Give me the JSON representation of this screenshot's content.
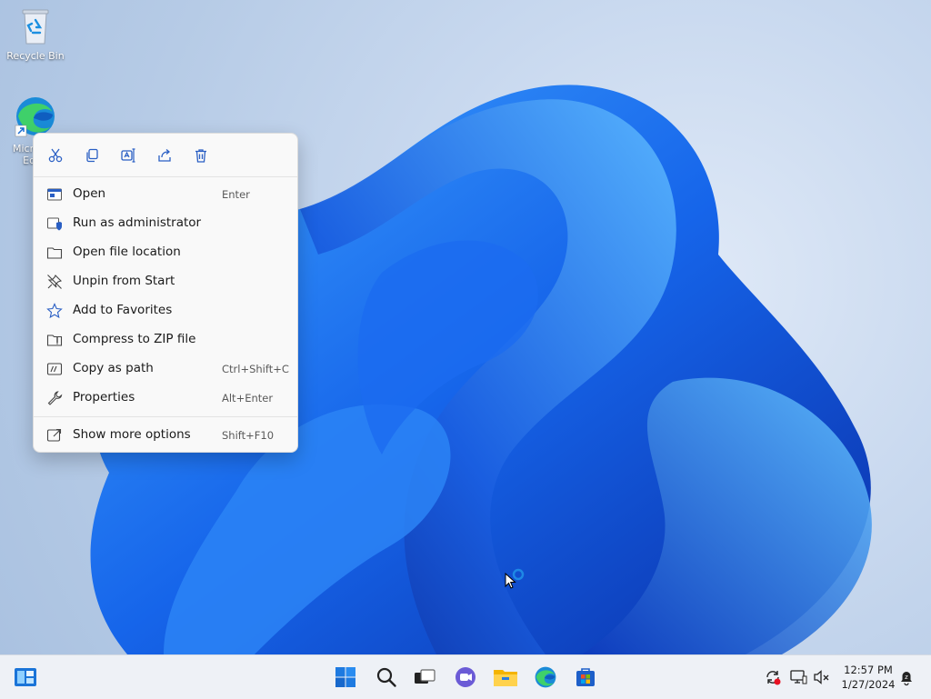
{
  "desktop": {
    "icons": [
      {
        "label": "Recycle Bin"
      },
      {
        "label": "Microsoft Edge"
      }
    ]
  },
  "context_menu": {
    "toolbar": [
      {
        "icon": "cut-icon"
      },
      {
        "icon": "copy-icon"
      },
      {
        "icon": "rename-icon"
      },
      {
        "icon": "share-icon"
      },
      {
        "icon": "delete-icon"
      }
    ],
    "items": [
      {
        "label": "Open",
        "shortcut": "Enter",
        "icon": "open-window-icon"
      },
      {
        "label": "Run as administrator",
        "shortcut": "",
        "icon": "admin-shield-icon"
      },
      {
        "label": "Open file location",
        "shortcut": "",
        "icon": "folder-icon"
      },
      {
        "label": "Unpin from Start",
        "shortcut": "",
        "icon": "unpin-icon"
      },
      {
        "label": "Add to Favorites",
        "shortcut": "",
        "icon": "star-icon"
      },
      {
        "label": "Compress to ZIP file",
        "shortcut": "",
        "icon": "zip-folder-icon"
      },
      {
        "label": "Copy as path",
        "shortcut": "Ctrl+Shift+C",
        "icon": "copy-path-icon"
      },
      {
        "label": "Properties",
        "shortcut": "Alt+Enter",
        "icon": "wrench-icon"
      },
      {
        "label": "Show more options",
        "shortcut": "Shift+F10",
        "icon": "external-open-icon"
      }
    ]
  },
  "taskbar": {
    "clock": {
      "time": "12:57 PM",
      "date": "1/27/2024"
    }
  },
  "colors": {
    "accent": "#0067c0",
    "wallpaper_blue": "#1460e8"
  }
}
